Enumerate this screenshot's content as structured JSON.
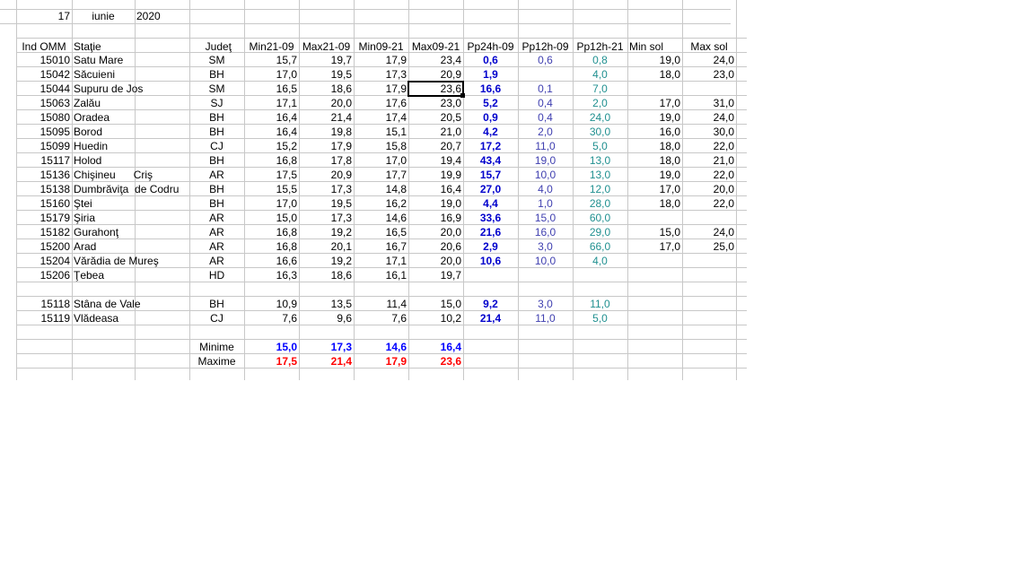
{
  "header": {
    "day": "17",
    "month": "iunie",
    "year": "2020"
  },
  "columns": [
    "Ind OMM",
    "Staţie",
    "Judeţ",
    "Min21-09",
    "Max21-09",
    "Min09-21",
    "Max09-21",
    "Pp24h-09",
    "Pp12h-09",
    "Pp12h-21",
    "Min sol",
    "Max sol"
  ],
  "rows": [
    [
      "15010",
      "Satu Mare",
      "SM",
      "15,7",
      "19,7",
      "17,9",
      "23,4",
      "0,6",
      "0,6",
      "0,8",
      "19,0",
      "24,0"
    ],
    [
      "15042",
      "Săcuieni",
      "BH",
      "17,0",
      "19,5",
      "17,3",
      "20,9",
      "1,9",
      "",
      "4,0",
      "18,0",
      "23,0"
    ],
    [
      "15044",
      "Supuru de Jos",
      "SM",
      "16,5",
      "18,6",
      "17,9",
      "23,6",
      "16,6",
      "0,1",
      "7,0",
      "",
      ""
    ],
    [
      "15063",
      "Zalău",
      "SJ",
      "17,1",
      "20,0",
      "17,6",
      "23,0",
      "5,2",
      "0,4",
      "2,0",
      "17,0",
      "31,0"
    ],
    [
      "15080",
      "Oradea",
      "BH",
      "16,4",
      "21,4",
      "17,4",
      "20,5",
      "0,9",
      "0,4",
      "24,0",
      "19,0",
      "24,0"
    ],
    [
      "15095",
      "Borod",
      "BH",
      "16,4",
      "19,8",
      "15,1",
      "21,0",
      "4,2",
      "2,0",
      "30,0",
      "16,0",
      "30,0"
    ],
    [
      "15099",
      "Huedin",
      "CJ",
      "15,2",
      "17,9",
      "15,8",
      "20,7",
      "17,2",
      "11,0",
      "5,0",
      "18,0",
      "22,0"
    ],
    [
      "15117",
      "Holod",
      "BH",
      "16,8",
      "17,8",
      "17,0",
      "19,4",
      "43,4",
      "19,0",
      "13,0",
      "18,0",
      "21,0"
    ],
    [
      "15136",
      "Chişineu      Criş",
      "AR",
      "17,5",
      "20,9",
      "17,7",
      "19,9",
      "15,7",
      "10,0",
      "13,0",
      "19,0",
      "22,0"
    ],
    [
      "15138",
      "Dumbrăviţa  de Codru",
      "BH",
      "15,5",
      "17,3",
      "14,8",
      "16,4",
      "27,0",
      "4,0",
      "12,0",
      "17,0",
      "20,0"
    ],
    [
      "15160",
      "Ştei",
      "BH",
      "17,0",
      "19,5",
      "16,2",
      "19,0",
      "4,4",
      "1,0",
      "28,0",
      "18,0",
      "22,0"
    ],
    [
      "15179",
      "Şiria",
      "AR",
      "15,0",
      "17,3",
      "14,6",
      "16,9",
      "33,6",
      "15,0",
      "60,0",
      "",
      ""
    ],
    [
      "15182",
      "Gurahonţ",
      "AR",
      "16,8",
      "19,2",
      "16,5",
      "20,0",
      "21,6",
      "16,0",
      "29,0",
      "15,0",
      "24,0"
    ],
    [
      "15200",
      "Arad",
      "AR",
      "16,8",
      "20,1",
      "16,7",
      "20,6",
      "2,9",
      "3,0",
      "66,0",
      "17,0",
      "25,0"
    ],
    [
      "15204",
      "Vărădia de Mureş",
      "AR",
      "16,6",
      "19,2",
      "17,1",
      "20,0",
      "10,6",
      "10,0",
      "4,0",
      "",
      ""
    ],
    [
      "15206",
      "Ţebea",
      "HD",
      "16,3",
      "18,6",
      "16,1",
      "19,7",
      "",
      "",
      "",
      "",
      ""
    ]
  ],
  "rows2": [
    [
      "15118",
      "Stâna de Vale",
      "BH",
      "10,9",
      "13,5",
      "11,4",
      "15,0",
      "9,2",
      "3,0",
      "11,0",
      "",
      ""
    ],
    [
      "15119",
      "Vlădeasa",
      "CJ",
      "7,6",
      "9,6",
      "7,6",
      "10,2",
      "21,4",
      "11,0",
      "5,0",
      "",
      ""
    ]
  ],
  "summary": {
    "min_label": "Minime",
    "max_label": "Maxime",
    "min": [
      "15,0",
      "17,3",
      "14,6",
      "16,4"
    ],
    "max": [
      "17,5",
      "21,4",
      "17,9",
      "23,6"
    ]
  },
  "colors": {
    "pp24": "#0000cc",
    "pp12_09": "#4040b0",
    "pp12_21": "#209090",
    "min_summary": "#0000ff",
    "max_summary": "#ff0000",
    "gridline": "#c8c8c8"
  }
}
